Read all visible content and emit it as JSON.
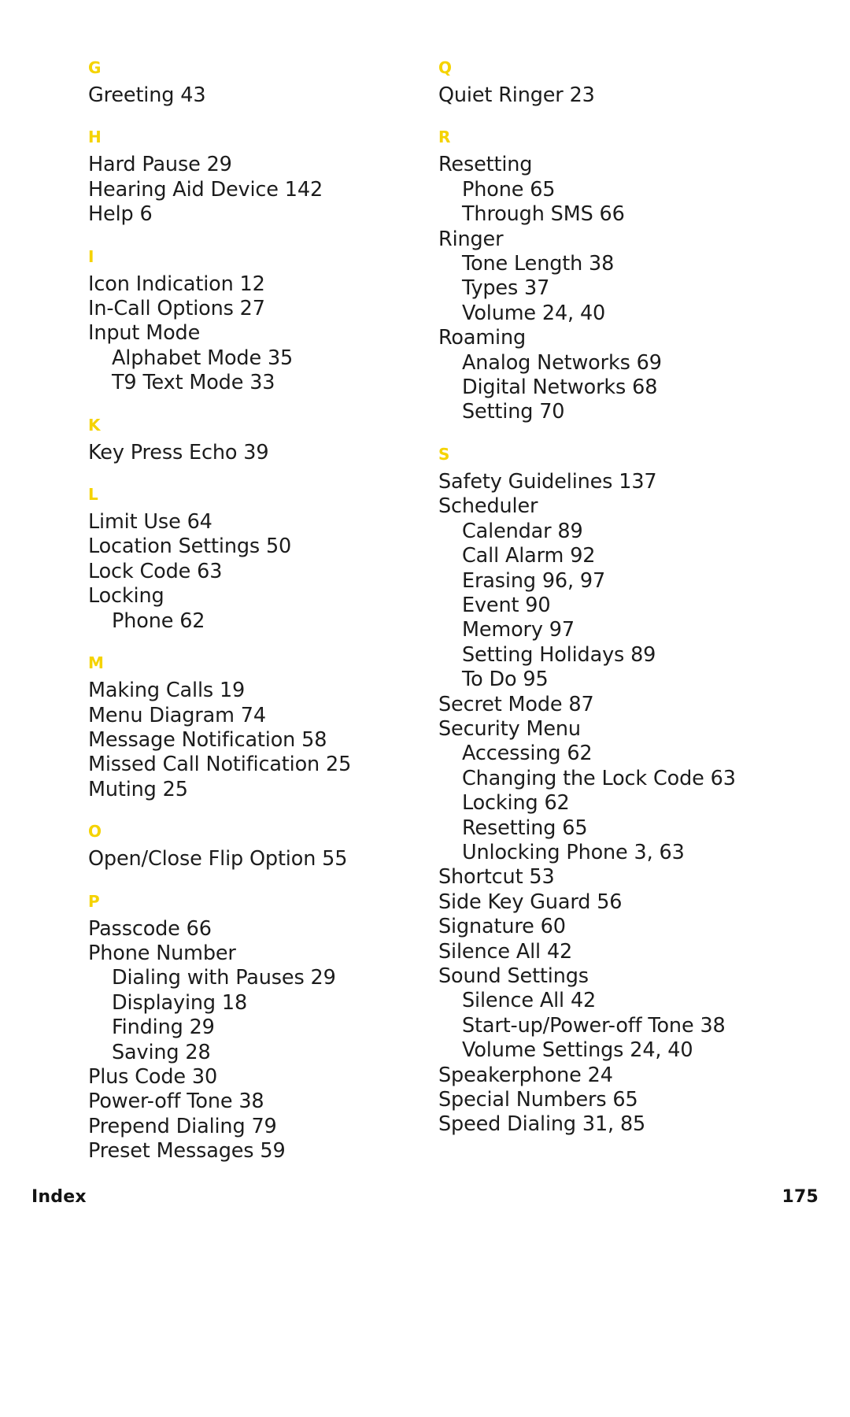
{
  "document": {
    "kind": "manual-index-page",
    "footer": {
      "label": "Index",
      "page_number": "175"
    },
    "accent_color": "#F5D300",
    "text_color": "#1C1C1C"
  },
  "columns": [
    {
      "id": "left",
      "blocks": [
        {
          "letter": "G",
          "entries": [
            {
              "text": "Greeting 43",
              "level": 0
            }
          ]
        },
        {
          "letter": "H",
          "entries": [
            {
              "text": "Hard Pause 29",
              "level": 0
            },
            {
              "text": "Hearing Aid Device 142",
              "level": 0
            },
            {
              "text": "Help 6",
              "level": 0
            }
          ]
        },
        {
          "letter": "I",
          "entries": [
            {
              "text": "Icon Indication 12",
              "level": 0
            },
            {
              "text": "In-Call Options 27",
              "level": 0
            },
            {
              "text": "Input Mode",
              "level": 0
            },
            {
              "text": "Alphabet Mode 35",
              "level": 1
            },
            {
              "text": "T9 Text Mode 33",
              "level": 1
            }
          ]
        },
        {
          "letter": "K",
          "entries": [
            {
              "text": "Key Press Echo 39",
              "level": 0
            }
          ]
        },
        {
          "letter": "L",
          "entries": [
            {
              "text": "Limit Use 64",
              "level": 0
            },
            {
              "text": "Location Settings 50",
              "level": 0
            },
            {
              "text": "Lock Code 63",
              "level": 0
            },
            {
              "text": "Locking",
              "level": 0
            },
            {
              "text": "Phone 62",
              "level": 1
            }
          ]
        },
        {
          "letter": "M",
          "entries": [
            {
              "text": "Making Calls 19",
              "level": 0
            },
            {
              "text": "Menu Diagram 74",
              "level": 0
            },
            {
              "text": "Message Notification 58",
              "level": 0
            },
            {
              "text": "Missed Call Notification 25",
              "level": 0
            },
            {
              "text": "Muting 25",
              "level": 0
            }
          ]
        },
        {
          "letter": "O",
          "entries": [
            {
              "text": "Open/Close Flip Option 55",
              "level": 0
            }
          ]
        },
        {
          "letter": "P",
          "entries": [
            {
              "text": "Passcode 66",
              "level": 0
            },
            {
              "text": "Phone Number",
              "level": 0
            },
            {
              "text": "Dialing with Pauses 29",
              "level": 1
            },
            {
              "text": "Displaying 18",
              "level": 1
            },
            {
              "text": "Finding 29",
              "level": 1
            },
            {
              "text": "Saving 28",
              "level": 1
            },
            {
              "text": "Plus Code 30",
              "level": 0
            },
            {
              "text": "Power-off Tone 38",
              "level": 0
            },
            {
              "text": "Prepend Dialing 79",
              "level": 0
            },
            {
              "text": "Preset Messages 59",
              "level": 0
            }
          ]
        }
      ]
    },
    {
      "id": "right",
      "blocks": [
        {
          "letter": "Q",
          "entries": [
            {
              "text": "Quiet Ringer 23",
              "level": 0
            }
          ]
        },
        {
          "letter": "R",
          "entries": [
            {
              "text": "Resetting",
              "level": 0
            },
            {
              "text": "Phone 65",
              "level": 1
            },
            {
              "text": "Through SMS 66",
              "level": 1
            },
            {
              "text": "Ringer",
              "level": 0
            },
            {
              "text": "Tone Length 38",
              "level": 1
            },
            {
              "text": "Types 37",
              "level": 1
            },
            {
              "text": "Volume 24, 40",
              "level": 1
            },
            {
              "text": "Roaming",
              "level": 0
            },
            {
              "text": "Analog Networks 69",
              "level": 1
            },
            {
              "text": "Digital Networks 68",
              "level": 1
            },
            {
              "text": "Setting 70",
              "level": 1
            }
          ]
        },
        {
          "letter": "S",
          "entries": [
            {
              "text": "Safety Guidelines 137",
              "level": 0
            },
            {
              "text": "Scheduler",
              "level": 0
            },
            {
              "text": "Calendar 89",
              "level": 1
            },
            {
              "text": "Call Alarm 92",
              "level": 1
            },
            {
              "text": "Erasing 96, 97",
              "level": 1
            },
            {
              "text": "Event 90",
              "level": 1
            },
            {
              "text": "Memory 97",
              "level": 1
            },
            {
              "text": "Setting Holidays 89",
              "level": 1
            },
            {
              "text": "To Do 95",
              "level": 1
            },
            {
              "text": "Secret Mode 87",
              "level": 0
            },
            {
              "text": "Security Menu",
              "level": 0
            },
            {
              "text": "Accessing 62",
              "level": 1
            },
            {
              "text": "Changing the Lock Code 63",
              "level": 1
            },
            {
              "text": "Locking 62",
              "level": 1
            },
            {
              "text": "Resetting 65",
              "level": 1
            },
            {
              "text": "Unlocking Phone 3, 63",
              "level": 1
            },
            {
              "text": "Shortcut 53",
              "level": 0
            },
            {
              "text": "Side Key Guard 56",
              "level": 0
            },
            {
              "text": "Signature 60",
              "level": 0
            },
            {
              "text": "Silence All 42",
              "level": 0
            },
            {
              "text": "Sound Settings",
              "level": 0
            },
            {
              "text": "Silence All 42",
              "level": 1
            },
            {
              "text": "Start-up/Power-off Tone 38",
              "level": 1
            },
            {
              "text": "Volume Settings 24, 40",
              "level": 1
            },
            {
              "text": "Speakerphone 24",
              "level": 0
            },
            {
              "text": "Special Numbers 65",
              "level": 0
            },
            {
              "text": "Speed Dialing 31, 85",
              "level": 0
            }
          ]
        }
      ]
    }
  ]
}
